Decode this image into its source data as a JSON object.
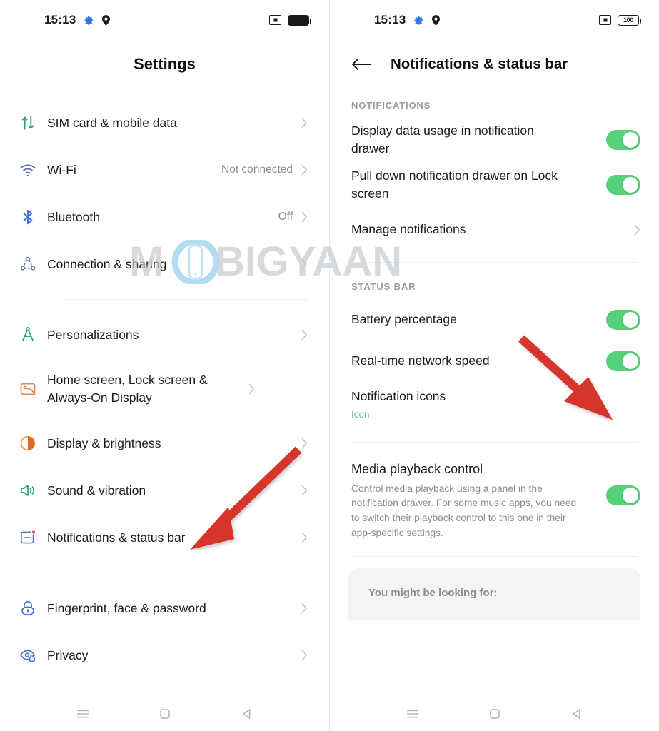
{
  "watermark": {
    "text_left": "M",
    "text_right": "BIGYAAN",
    "logo": "phone-circle-logo"
  },
  "left_panel": {
    "status_bar": {
      "time": "15:13",
      "icons": [
        "gear-icon",
        "location-pin-icon"
      ],
      "right_icons": [
        "cast-icon",
        "battery-full-icon"
      ],
      "battery_label": ""
    },
    "title": "Settings",
    "groups": [
      {
        "items": [
          {
            "icon": "sim-data-transfer-icon",
            "label": "SIM card & mobile data",
            "value": "",
            "chevron": true
          },
          {
            "icon": "wifi-icon",
            "label": "Wi-Fi",
            "value": "Not connected",
            "chevron": true
          },
          {
            "icon": "bluetooth-icon",
            "label": "Bluetooth",
            "value": "Off",
            "chevron": true
          },
          {
            "icon": "connection-sharing-icon",
            "label": "Connection & sharing",
            "value": "",
            "chevron": true
          }
        ]
      },
      {
        "items": [
          {
            "icon": "compass-personalization-icon",
            "label": "Personalizations",
            "value": "",
            "chevron": true
          },
          {
            "icon": "wallpaper-icon",
            "label": "Home screen, Lock screen & Always-On Display",
            "value": "",
            "chevron": true
          },
          {
            "icon": "brightness-icon",
            "label": "Display & brightness",
            "value": "",
            "chevron": true
          },
          {
            "icon": "speaker-icon",
            "label": "Sound & vibration",
            "value": "",
            "chevron": true
          },
          {
            "icon": "notification-badge-icon",
            "label": "Notifications & status bar",
            "value": "",
            "chevron": true
          }
        ]
      },
      {
        "items": [
          {
            "icon": "lock-icon",
            "label": "Fingerprint, face & password",
            "value": "",
            "chevron": true
          },
          {
            "icon": "privacy-eye-icon",
            "label": "Privacy",
            "value": "",
            "chevron": true
          }
        ]
      }
    ],
    "navbar": [
      "menu-icon",
      "home-square-icon",
      "back-triangle-icon"
    ]
  },
  "right_panel": {
    "status_bar": {
      "time": "15:13",
      "icons": [
        "gear-icon",
        "location-pin-icon"
      ],
      "right_icons": [
        "cast-icon",
        "battery-percent-icon"
      ],
      "battery_label": "100"
    },
    "back_icon": "back-arrow-icon",
    "title": "Notifications & status bar",
    "sections": [
      {
        "heading": "NOTIFICATIONS",
        "items": [
          {
            "type": "toggle",
            "title": "Display data usage in notification drawer",
            "subtitle": "",
            "desc": "",
            "on": true
          },
          {
            "type": "toggle",
            "title": "Pull down notification drawer on Lock screen",
            "subtitle": "",
            "desc": "",
            "on": true
          },
          {
            "type": "link",
            "title": "Manage notifications",
            "subtitle": "",
            "desc": "",
            "on": false
          }
        ]
      },
      {
        "heading": "STATUS BAR",
        "items": [
          {
            "type": "toggle",
            "title": "Battery percentage",
            "subtitle": "",
            "desc": "",
            "on": true
          },
          {
            "type": "toggle",
            "title": "Real-time network speed",
            "subtitle": "",
            "desc": "",
            "on": true
          },
          {
            "type": "value",
            "title": "Notification icons",
            "subtitle": "Icon",
            "desc": "",
            "on": false
          }
        ]
      },
      {
        "heading": "",
        "items": [
          {
            "type": "toggle",
            "title": "Media playback control",
            "subtitle": "",
            "desc": "Control media playback using a panel in the notification drawer. For some music apps, you need to switch their playback control to this one in their app-specific settings.",
            "on": true
          }
        ]
      }
    ],
    "looking_for_label": "You might be looking for:",
    "navbar": [
      "menu-icon",
      "home-square-icon",
      "back-triangle-icon"
    ]
  },
  "annotations": {
    "arrow_left": {
      "name": "red-arrow-pointing-to-notifications-status-bar",
      "color": "#D5342B"
    },
    "arrow_right": {
      "name": "red-arrow-pointing-to-real-time-network-speed-toggle",
      "color": "#D5342B"
    }
  },
  "colors": {
    "toggle_on": "#56d17a",
    "accent_green": "#62c08b",
    "arrow_red": "#D5342B",
    "text_primary": "#1c1c1c",
    "text_secondary": "#8b8b90"
  }
}
